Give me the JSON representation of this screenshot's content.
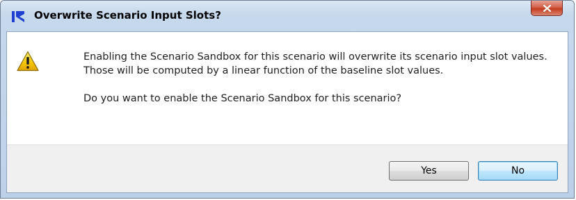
{
  "window": {
    "title": "Overwrite Scenario Input Slots?",
    "app_icon": "riverware-logo-icon",
    "close_icon": "close-icon"
  },
  "message": {
    "icon": "warning-icon",
    "body": "Enabling the Scenario Sandbox for this scenario will overwrite its scenario input slot values. Those will be computed by a linear function of the baseline slot values.",
    "question": "Do you want to enable the Scenario Sandbox for this scenario?"
  },
  "buttons": {
    "yes_label": "Yes",
    "no_label": "No"
  },
  "colors": {
    "title_bar": "#c6d8ec",
    "close_button": "#c53c22",
    "warning_fill": "#f5c400",
    "app_icon_blue": "#1f3fd2",
    "default_button_border": "#3c7fb1"
  }
}
